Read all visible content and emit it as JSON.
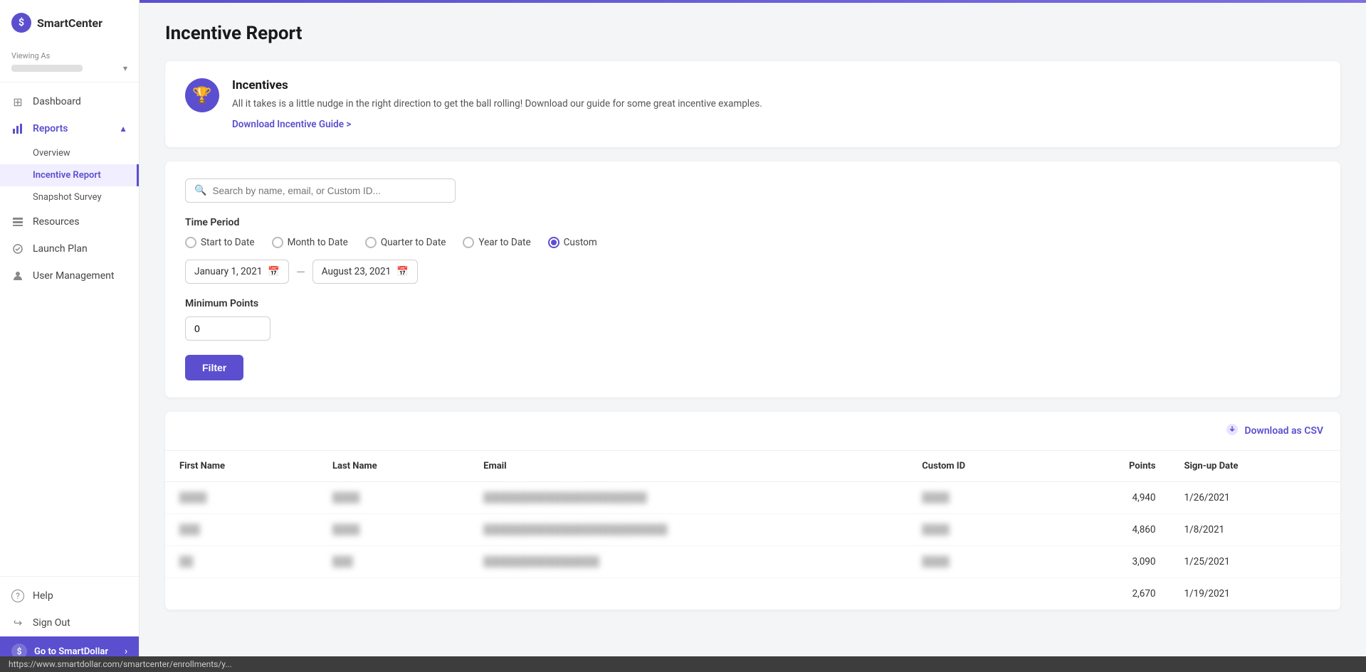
{
  "brand": {
    "logo_icon": "$",
    "logo_text": "SmartCenter"
  },
  "sidebar": {
    "viewing_as_label": "Viewing As",
    "nav_items": [
      {
        "id": "dashboard",
        "label": "Dashboard",
        "icon": "⊞"
      },
      {
        "id": "reports",
        "label": "Reports",
        "icon": "📊",
        "expanded": true,
        "sub_items": [
          {
            "id": "overview",
            "label": "Overview",
            "active": false
          },
          {
            "id": "incentive-report",
            "label": "Incentive Report",
            "active": true
          },
          {
            "id": "snapshot-survey",
            "label": "Snapshot Survey",
            "active": false
          }
        ]
      },
      {
        "id": "resources",
        "label": "Resources",
        "icon": "🗂"
      },
      {
        "id": "launch-plan",
        "label": "Launch Plan",
        "icon": "🚀"
      },
      {
        "id": "user-management",
        "label": "User Management",
        "icon": "👤"
      }
    ],
    "bottom_items": [
      {
        "id": "help",
        "label": "Help",
        "icon": "?"
      },
      {
        "id": "sign-out",
        "label": "Sign Out",
        "icon": "↪"
      }
    ],
    "go_to_smartdollar": "Go to SmartDollar"
  },
  "page": {
    "title": "Incentive Report"
  },
  "incentives_card": {
    "title": "Incentives",
    "description": "All it takes is a little nudge in the right direction to get the ball rolling! Download our guide for some great incentive examples.",
    "link_text": "Download Incentive Guide >",
    "trophy_icon": "🏆"
  },
  "filter": {
    "search_placeholder": "Search by name, email, or Custom ID...",
    "time_period_label": "Time Period",
    "radio_options": [
      {
        "id": "start-to-date",
        "label": "Start to Date",
        "selected": false
      },
      {
        "id": "month-to-date",
        "label": "Month to Date",
        "selected": false
      },
      {
        "id": "quarter-to-date",
        "label": "Quarter to Date",
        "selected": false
      },
      {
        "id": "year-to-date",
        "label": "Year to Date",
        "selected": false
      },
      {
        "id": "custom",
        "label": "Custom",
        "selected": true
      }
    ],
    "start_date": "January 1, 2021",
    "end_date": "August 23, 2021",
    "min_points_label": "Minimum Points",
    "min_points_value": "0",
    "filter_button_label": "Filter"
  },
  "table": {
    "download_csv_label": "Download as CSV",
    "columns": [
      "First Name",
      "Last Name",
      "Email",
      "Custom ID",
      "Points",
      "Sign-up Date"
    ],
    "rows": [
      {
        "first_name": "████",
        "last_name": "████",
        "email": "████████████████████████",
        "custom_id": "████",
        "points": "4,940",
        "signup_date": "1/26/2021"
      },
      {
        "first_name": "███",
        "last_name": "████",
        "email": "███████████████████████████",
        "custom_id": "████",
        "points": "4,860",
        "signup_date": "1/8/2021"
      },
      {
        "first_name": "██",
        "last_name": "███",
        "email": "█████████████████",
        "custom_id": "████",
        "points": "3,090",
        "signup_date": "1/25/2021"
      },
      {
        "first_name": "",
        "last_name": "",
        "email": "",
        "custom_id": "",
        "points": "2,670",
        "signup_date": "1/19/2021"
      }
    ]
  },
  "status_bar": {
    "url": "https://www.smartdollar.com/smartcenter/enrollments/y..."
  }
}
